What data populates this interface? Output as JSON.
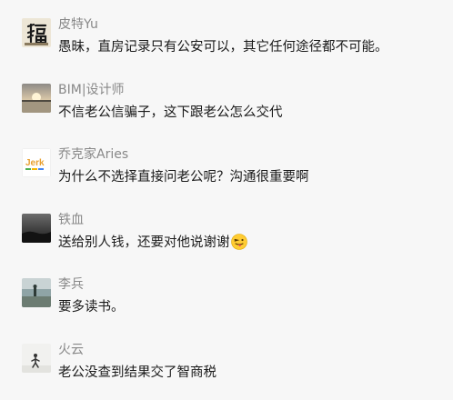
{
  "comments": [
    {
      "nickname": "皮特Yu",
      "content": "愚昧，直房记录只有公安可以，其它任何途径都不可能。",
      "avatar_icon": "fu-calligraphy-avatar"
    },
    {
      "nickname": "BIM|设计师",
      "content": "不信老公信骗子，这下跟老公怎么交代",
      "avatar_icon": "sunset-lake-avatar"
    },
    {
      "nickname": "乔克家Aries",
      "content": "为什么不选择直接问老公呢？沟通很重要啊",
      "avatar_icon": "jerk-logo-avatar",
      "avatar_text": "Jerk"
    },
    {
      "nickname": "铁血",
      "content": "送给别人钱，还要对他说谢谢",
      "avatar_icon": "dark-landscape-avatar",
      "trailing_emoji": "tongue-out-face-icon"
    },
    {
      "nickname": "李兵",
      "content": "要多读书。",
      "avatar_icon": "seaside-avatar"
    },
    {
      "nickname": "火云",
      "content": "老公没查到结果交了智商税",
      "avatar_icon": "snow-figure-avatar"
    }
  ]
}
